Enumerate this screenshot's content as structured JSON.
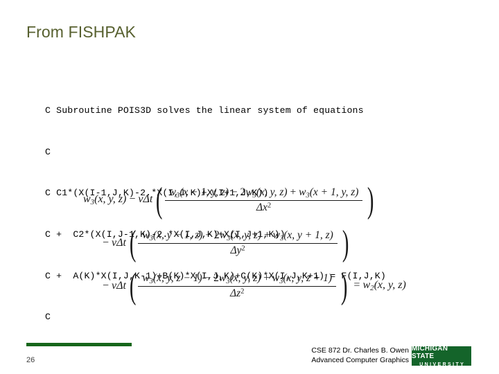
{
  "slide": {
    "title": "From FISHPAK",
    "page_number": "26",
    "title_color": "#57602f",
    "accent_color": "#16661b"
  },
  "code": {
    "lines": [
      "C Subroutine POIS3D solves the linear system of equations",
      "C",
      "C C1*(X(I-1,J,K)-2.*X(I,J,K)+X(I+1,J,K))",
      "C +  C2*(X(I,J-1,K)-2.*X(I,J,K)+X(I,J+1,K))",
      "C +  A(K)*X(I,J,K-1)+B(K)*X(I,J,K)+C(K)*X(I,J,K+1) = F(I,J,K)",
      "C"
    ]
  },
  "equation": {
    "row1": {
      "lead_w": "w",
      "lead_sub": "3",
      "lead_args": "(x, y, z)",
      "lead_minus": " − ",
      "lead_nu": "v",
      "lead_delta_t": "Δt",
      "numerator_a_w": "w",
      "numerator_a_sub": "3",
      "numerator_a_args": "(x − 1, y, z)",
      "numerator_minus": " − 2",
      "numerator_b_w": "w",
      "numerator_b_sub": "3",
      "numerator_b_args": "(x, y, z)",
      "numerator_plus": " + ",
      "numerator_c_w": "w",
      "numerator_c_sub": "3",
      "numerator_c_args": "(x + 1, y, z)",
      "denominator_delta": "Δx",
      "denominator_exp": "2"
    },
    "row2": {
      "lead_minus": "− ",
      "lead_nu": "v",
      "lead_delta_t": "Δt",
      "numerator_a_w": "w",
      "numerator_a_sub": "3",
      "numerator_a_args": "(x, y − 1, z)",
      "numerator_minus": " − 2",
      "numerator_b_w": "w",
      "numerator_b_sub": "3",
      "numerator_b_args": "(x, y, z)",
      "numerator_plus": " + ",
      "numerator_c_w": "w",
      "numerator_c_sub": "3",
      "numerator_c_args": "(x, y + 1, z)",
      "denominator_delta": "Δy",
      "denominator_exp": "2"
    },
    "row3": {
      "lead_minus": "− ",
      "lead_nu": "v",
      "lead_delta_t": "Δt",
      "numerator_a_w": "w",
      "numerator_a_sub": "3",
      "numerator_a_args": "(x, y, z − 1)",
      "numerator_minus": " − 2",
      "numerator_b_w": "w",
      "numerator_b_sub": "3",
      "numerator_b_args": "(x, y, z)",
      "numerator_plus": " + ",
      "numerator_c_w": "w",
      "numerator_c_sub": "3",
      "numerator_c_args": "(x, y, z + 1)",
      "denominator_delta": "Δz",
      "denominator_exp": "2",
      "equals": "= ",
      "rhs_w": "w",
      "rhs_sub": "2",
      "rhs_args": "(x, y, z)"
    },
    "paren_open": "(",
    "paren_close": ")"
  },
  "footer": {
    "line1": "CSE 872 Dr. Charles B. Owen",
    "line2": "Advanced Computer Graphics",
    "logo_top": "MICHIGAN STATE",
    "logo_bottom": "UNIVERSITY"
  }
}
